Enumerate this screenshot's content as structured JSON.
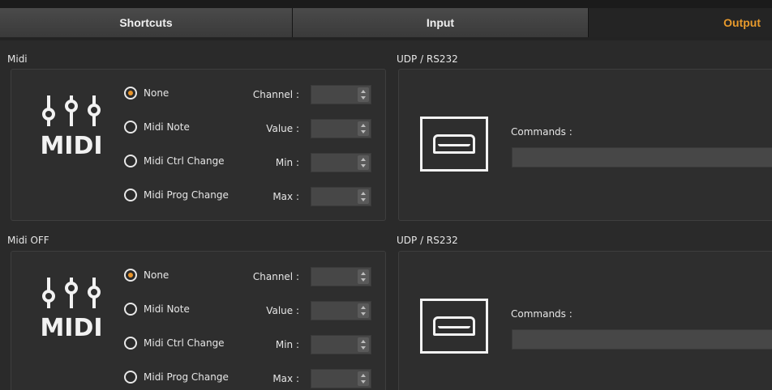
{
  "tabs": [
    {
      "label": "Shortcuts"
    },
    {
      "label": "Input"
    },
    {
      "label": "Output",
      "active": true
    }
  ],
  "colors": {
    "accent": "#e89a2c",
    "background": "#2a2a2a",
    "field": "#474747"
  },
  "midi_sections": [
    {
      "title": "Midi",
      "logo_text": "MIDI",
      "options": [
        "None",
        "Midi Note",
        "Midi Ctrl Change",
        "Midi Prog Change"
      ],
      "selected": "None",
      "fields": [
        {
          "label": "Channel :",
          "value": ""
        },
        {
          "label": "Value :",
          "value": ""
        },
        {
          "label": "Min :",
          "value": ""
        },
        {
          "label": "Max :",
          "value": ""
        }
      ]
    },
    {
      "title": "Midi OFF",
      "logo_text": "MIDI",
      "options": [
        "None",
        "Midi Note",
        "Midi Ctrl Change",
        "Midi Prog Change"
      ],
      "selected": "None",
      "fields": [
        {
          "label": "Channel :",
          "value": ""
        },
        {
          "label": "Value :",
          "value": ""
        },
        {
          "label": "Min :",
          "value": ""
        },
        {
          "label": "Max :",
          "value": ""
        }
      ]
    }
  ],
  "udp_sections": [
    {
      "title": "UDP / RS232",
      "commands_label": "Commands :",
      "commands_value": "",
      "icon": "serial-port-icon"
    },
    {
      "title": "UDP / RS232",
      "commands_label": "Commands :",
      "commands_value": "",
      "icon": "serial-port-icon"
    }
  ]
}
